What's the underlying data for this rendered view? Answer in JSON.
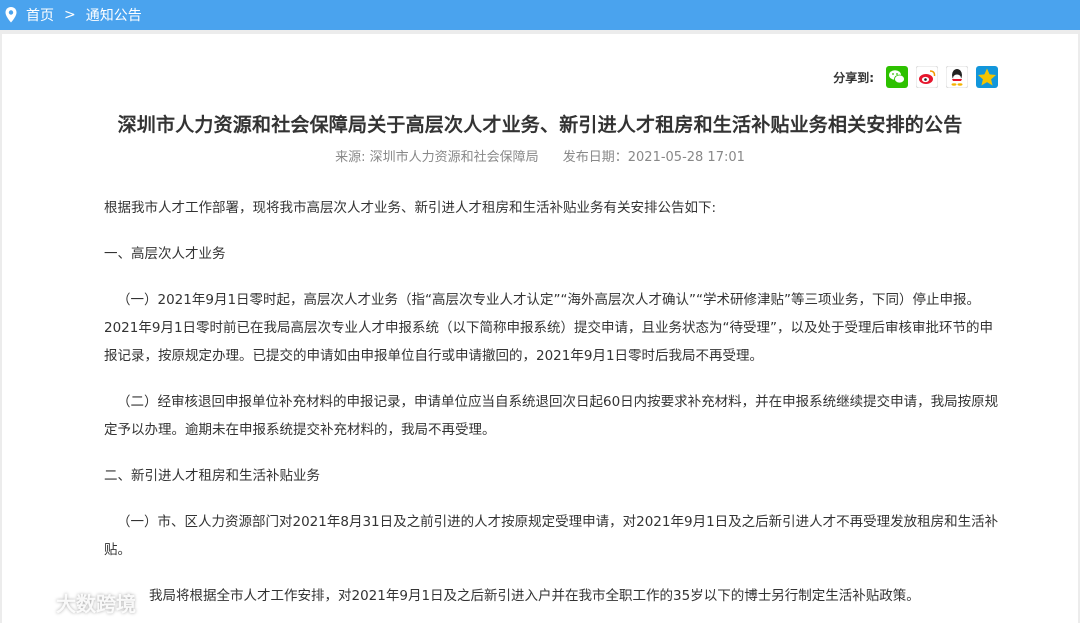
{
  "breadcrumb": {
    "home": "首页",
    "separator": ">",
    "current": "通知公告"
  },
  "share": {
    "label": "分享到:",
    "icons": [
      "wechat-icon",
      "weibo-icon",
      "qq-icon",
      "qzone-icon"
    ]
  },
  "article": {
    "title": "深圳市人力资源和社会保障局关于高层次人才业务、新引进人才租房和生活补贴业务相关安排的公告",
    "source": "来源: 深圳市人力资源和社会保障局",
    "date": "发布日期：2021-05-28 17:01",
    "intro": "根据我市人才工作部署，现将我市高层次人才业务、新引进人才租房和生活补贴业务有关安排公告如下:",
    "section1_heading": "一、高层次人才业务",
    "section1_p1": "（一）2021年9月1日零时起，高层次人才业务（指“高层次专业人才认定”“海外高层次人才确认”“学术研修津贴”等三项业务，下同）停止申报。2021年9月1日零时前已在我局高层次专业人才申报系统（以下简称申报系统）提交申请，且业务状态为“待受理”，以及处于受理后审核审批环节的申报记录，按原规定办理。已提交的申请如由申报单位自行或申请撤回的，2021年9月1日零时后我局不再受理。",
    "section1_p2": "（二）经审核退回申报单位补充材料的申报记录，申请单位应当自系统退回次日起60日内按要求补充材料，并在申报系统继续提交申请，我局按原规定予以办理。逾期未在申报系统提交补充材料的，我局不再受理。",
    "section2_heading": "二、新引进人才租房和生活补贴业务",
    "section2_p1": "（一）市、区人力资源部门对2021年8月31日及之前引进的人才按原规定受理申请，对2021年9月1日及之后新引进人才不再受理发放租房和生活补贴。",
    "section2_p2": "我局将根据全市人才工作安排，对2021年9月1日及之后新引进入户并在我市全职工作的35岁以下的博士另行制定生活补贴政策。"
  },
  "watermark": {
    "text": "大数跨境"
  },
  "colors": {
    "header_bg": "#4aa3ee",
    "page_bg": "#ececec",
    "card_bg": "#ffffff",
    "wechat": "#2dc100",
    "weibo": "#e6162d",
    "qq": "#1296db",
    "qzone": "#f5b400"
  }
}
